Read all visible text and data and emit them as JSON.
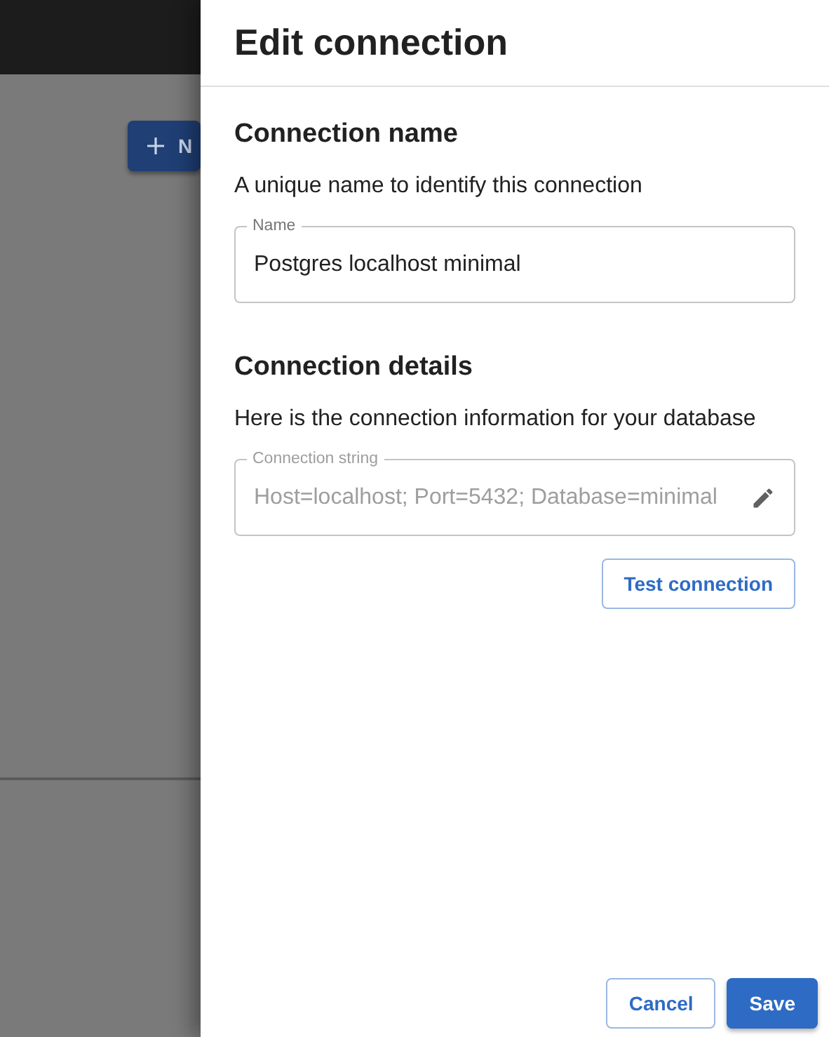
{
  "background": {
    "new_button": {
      "label": "N"
    }
  },
  "drawer": {
    "title": "Edit connection",
    "sections": [
      {
        "heading": "Connection name",
        "description": "A unique name to identify this connection",
        "field": {
          "label": "Name",
          "value": "Postgres localhost minimal",
          "disabled": false
        }
      },
      {
        "heading": "Connection details",
        "description": "Here is the connection information for your database",
        "field": {
          "label": "Connection string",
          "value": "Host=localhost; Port=5432; Database=minimal",
          "disabled": true
        },
        "action": "Test connection"
      }
    ],
    "buttons": [
      {
        "label": "Cancel",
        "kind": "outlined"
      },
      {
        "label": "Save",
        "kind": "filled"
      }
    ]
  }
}
